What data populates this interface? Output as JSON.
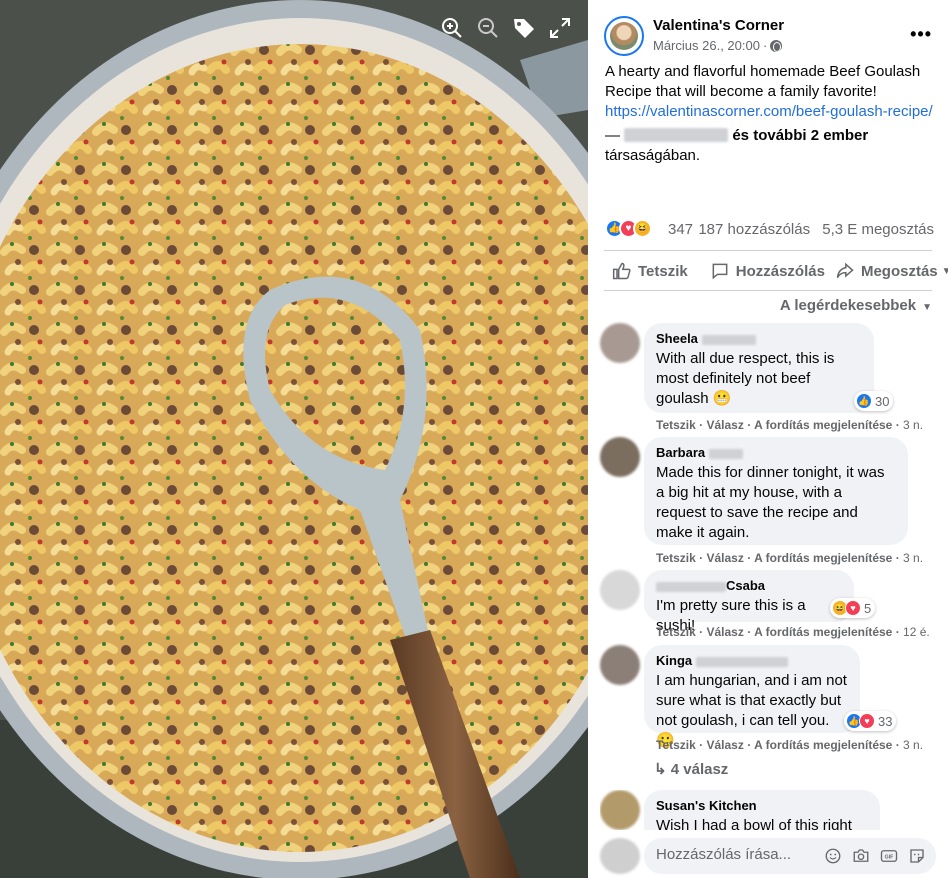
{
  "photo": {
    "tools": [
      "zoom-in-icon",
      "zoom-out-icon",
      "tag-icon",
      "fullscreen-icon"
    ]
  },
  "post": {
    "page_name": "Valentina's Corner",
    "date": "Március 26., 20:00",
    "separator": "·",
    "text": "A hearty and flavorful homemade Beef Goulash Recipe that will become a family favorite!",
    "link": "https://valentinascorner.com/beef-goulash-recipe/",
    "tagged_prefix": "—",
    "tagged_rest_bold": "és további 2 ember",
    "tagged_suffix": "társaságában.",
    "reaction_count": "347",
    "comment_count": "187 hozzászólás",
    "share_count": "5,3 E megosztás"
  },
  "actions": {
    "like": "Tetszik",
    "comment": "Hozzászólás",
    "share": "Megosztás"
  },
  "sort_label": "A legérdekesebbek",
  "comment_actions": {
    "like": "Tetszik",
    "reply": "Válasz",
    "translate": "A fordítás megjelenítése",
    "dot": "·"
  },
  "comments": [
    {
      "name": "Sheela",
      "text": "With all due respect, this is most definitely not beef goulash 😬",
      "reactions": "30",
      "time": "3 n."
    },
    {
      "name": "Barbara",
      "text": "Made this for dinner tonight, it was a big hit at my house, with a request to save the recipe and make it again.",
      "time": "3 n."
    },
    {
      "name": "Csaba",
      "text": "I'm pretty sure this is a sushi!",
      "reactions": "5",
      "time": "12 é."
    },
    {
      "name": "Kinga",
      "text": "I am hungarian, and i am not sure what is that exactly but not goulash, i can tell you. 🙂",
      "reactions": "33",
      "time": "3 n."
    },
    {
      "name": "Susan's Kitchen",
      "text": "Wish I had a bowl of this right"
    }
  ],
  "replies_label": "4 válasz",
  "composer": {
    "placeholder": "Hozzászólás írása..."
  },
  "colors": {
    "link": "#216fdb",
    "secondary_text": "#65676b",
    "bubble": "#f0f2f5",
    "like_blue": "#1877f2",
    "love_red": "#f33e58"
  }
}
